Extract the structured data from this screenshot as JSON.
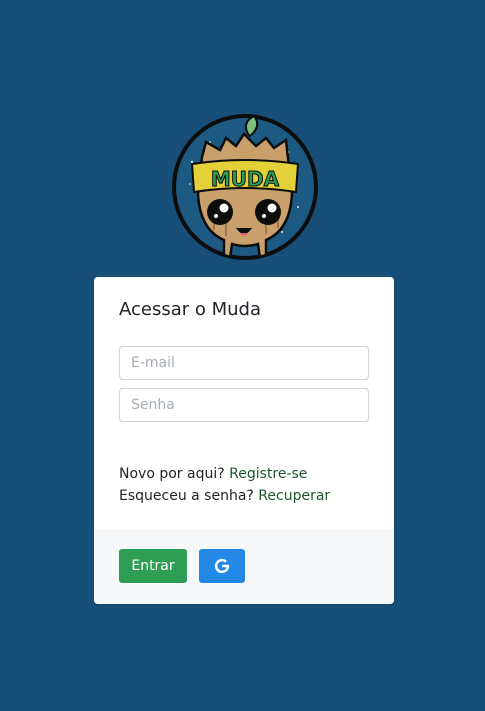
{
  "logo": {
    "text": "MUDA",
    "icon": "groot-logo-icon"
  },
  "card": {
    "title": "Acessar o Muda",
    "email_placeholder": "E-mail",
    "senha_placeholder": "Senha",
    "novo_text": "Novo por aqui?",
    "registre_link": "Registre-se",
    "esqueceu_text": "Esqueceu a senha?",
    "recuperar_link": "Recuperar"
  },
  "footer": {
    "entrar_label": "Entrar",
    "google_icon": "google-icon"
  },
  "colors": {
    "background": "#174f78",
    "entrar_button": "#2f9e55",
    "google_button": "#2289e6",
    "link": "#1e5631"
  }
}
